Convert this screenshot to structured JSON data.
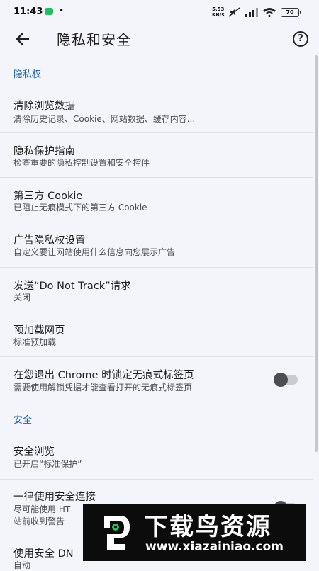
{
  "status_bar": {
    "time": "11:43",
    "dot": "•",
    "net_speed": "5.53",
    "net_unit": "KB/s",
    "battery": "70"
  },
  "header": {
    "title": "隐私和安全",
    "help": "?"
  },
  "sections": {
    "privacy": "隐私权",
    "security": "安全"
  },
  "items": [
    {
      "title": "清除浏览数据",
      "subtitle": "清除历史记录、Cookie、网站数据、缓存内容..."
    },
    {
      "title": "隐私保护指南",
      "subtitle": "检查重要的隐私控制设置和安全控件"
    },
    {
      "title": "第三方 Cookie",
      "subtitle": "已阻止无痕模式下的第三方 Cookie"
    },
    {
      "title": "广告隐私权设置",
      "subtitle": "自定义要让网站使用什么信息向您展示广告"
    },
    {
      "title": "发送“Do Not Track”请求",
      "subtitle": "关闭"
    },
    {
      "title": "预加载网页",
      "subtitle": "标准预加载"
    },
    {
      "title": "在您退出 Chrome 时锁定无痕式标签页",
      "subtitle": "需要使用解锁凭据才能查看打开的无痕式标签页",
      "toggle": "off"
    },
    {
      "title": "安全浏览",
      "subtitle": "已开启“标准保护”"
    },
    {
      "title": "一律使用安全连接",
      "subtitle": "尽可能使用 HT",
      "subtitle2": "站前收到警告",
      "toggle": "off"
    },
    {
      "title": "使用安全 DN",
      "subtitle": "自动"
    }
  ],
  "watermark": {
    "name": "下载鸟资源",
    "url": "www.xiazainiao.com"
  }
}
